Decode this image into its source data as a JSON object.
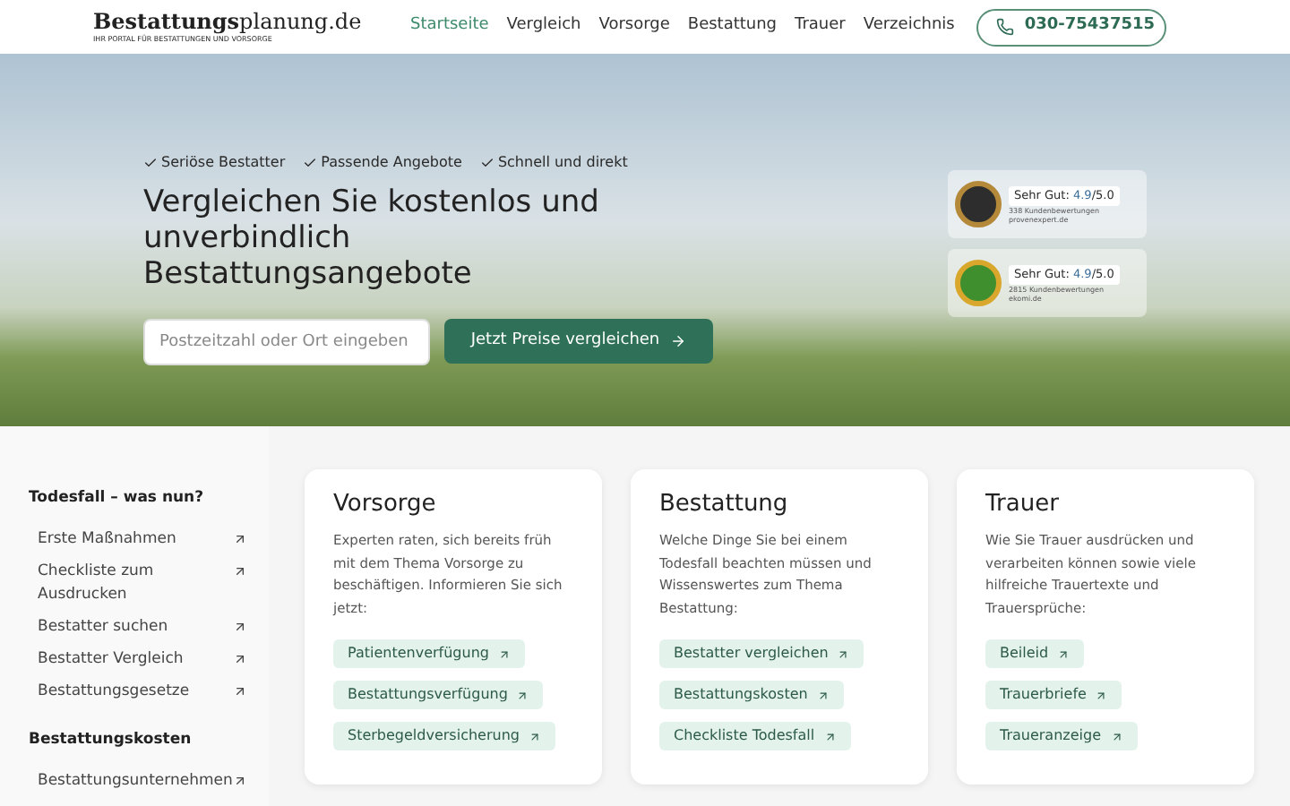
{
  "header": {
    "logo_bold": "Bestattungs",
    "logo_light": "planung.de",
    "tagline": "IHR PORTAL FÜR BESTATTUNGEN UND VORSORGE",
    "nav": [
      {
        "label": "Startseite",
        "selected": true
      },
      {
        "label": "Vergleich",
        "selected": false
      },
      {
        "label": "Vorsorge",
        "selected": false
      },
      {
        "label": "Bestattung",
        "selected": false
      },
      {
        "label": "Trauer",
        "selected": false
      },
      {
        "label": "Verzeichnis",
        "selected": false
      }
    ],
    "phone": "030-75437515"
  },
  "hero": {
    "benefits": [
      "Seriöse Bestatter",
      "Passende Angebote",
      "Schnell und direkt"
    ],
    "headline": "Vergleichen Sie kostenlos und unverbindlich Bestattungsangebote",
    "search": {
      "placeholder": "Postzeitzahl oder Ort eingeben"
    },
    "button": "Jetzt Preise vergleichen",
    "ratings": [
      {
        "label": "Sehr Gut:",
        "score": "4.9",
        "scale": "/5.0",
        "reviews": "338 Kundenbewertungen",
        "source": "provenexpert.de"
      },
      {
        "label": "Sehr Gut:",
        "score": "4.9",
        "scale": "/5.0",
        "reviews": "2815 Kundenbewertungen",
        "source": "ekomi.de"
      }
    ]
  },
  "sidebar": [
    {
      "title": "Todesfall – was nun?",
      "items": [
        "Erste Maßnahmen",
        "Checkliste zum Ausdrucken",
        "Bestatter suchen",
        "Bestatter Vergleich",
        "Bestattungsgesetze"
      ]
    },
    {
      "title": "Bestattungskosten",
      "items": [
        "Bestattungsunternehmen"
      ]
    }
  ],
  "cards": [
    {
      "title": "Vorsorge",
      "text": "Experten raten, sich bereits früh mit dem Thema Vorsorge zu beschäftigen. Informieren Sie sich jetzt:",
      "links": [
        "Patientenverfügung",
        "Bestattungsverfügung",
        "Sterbegeldversicherung"
      ]
    },
    {
      "title": "Bestattung",
      "text": "Welche Dinge Sie bei einem Todesfall beachten müssen und Wissenswertes zum Thema Bestattung:",
      "links": [
        "Bestatter vergleichen",
        "Bestattungskosten",
        "Checkliste Todesfall"
      ]
    },
    {
      "title": "Trauer",
      "text": "Wie Sie Trauer ausdrücken und verarbeiten können sowie viele hilfreiche Trauertexte und Trauersprüche:",
      "links": [
        "Beileid",
        "Trauerbriefe",
        "Traueranzeige"
      ]
    }
  ]
}
